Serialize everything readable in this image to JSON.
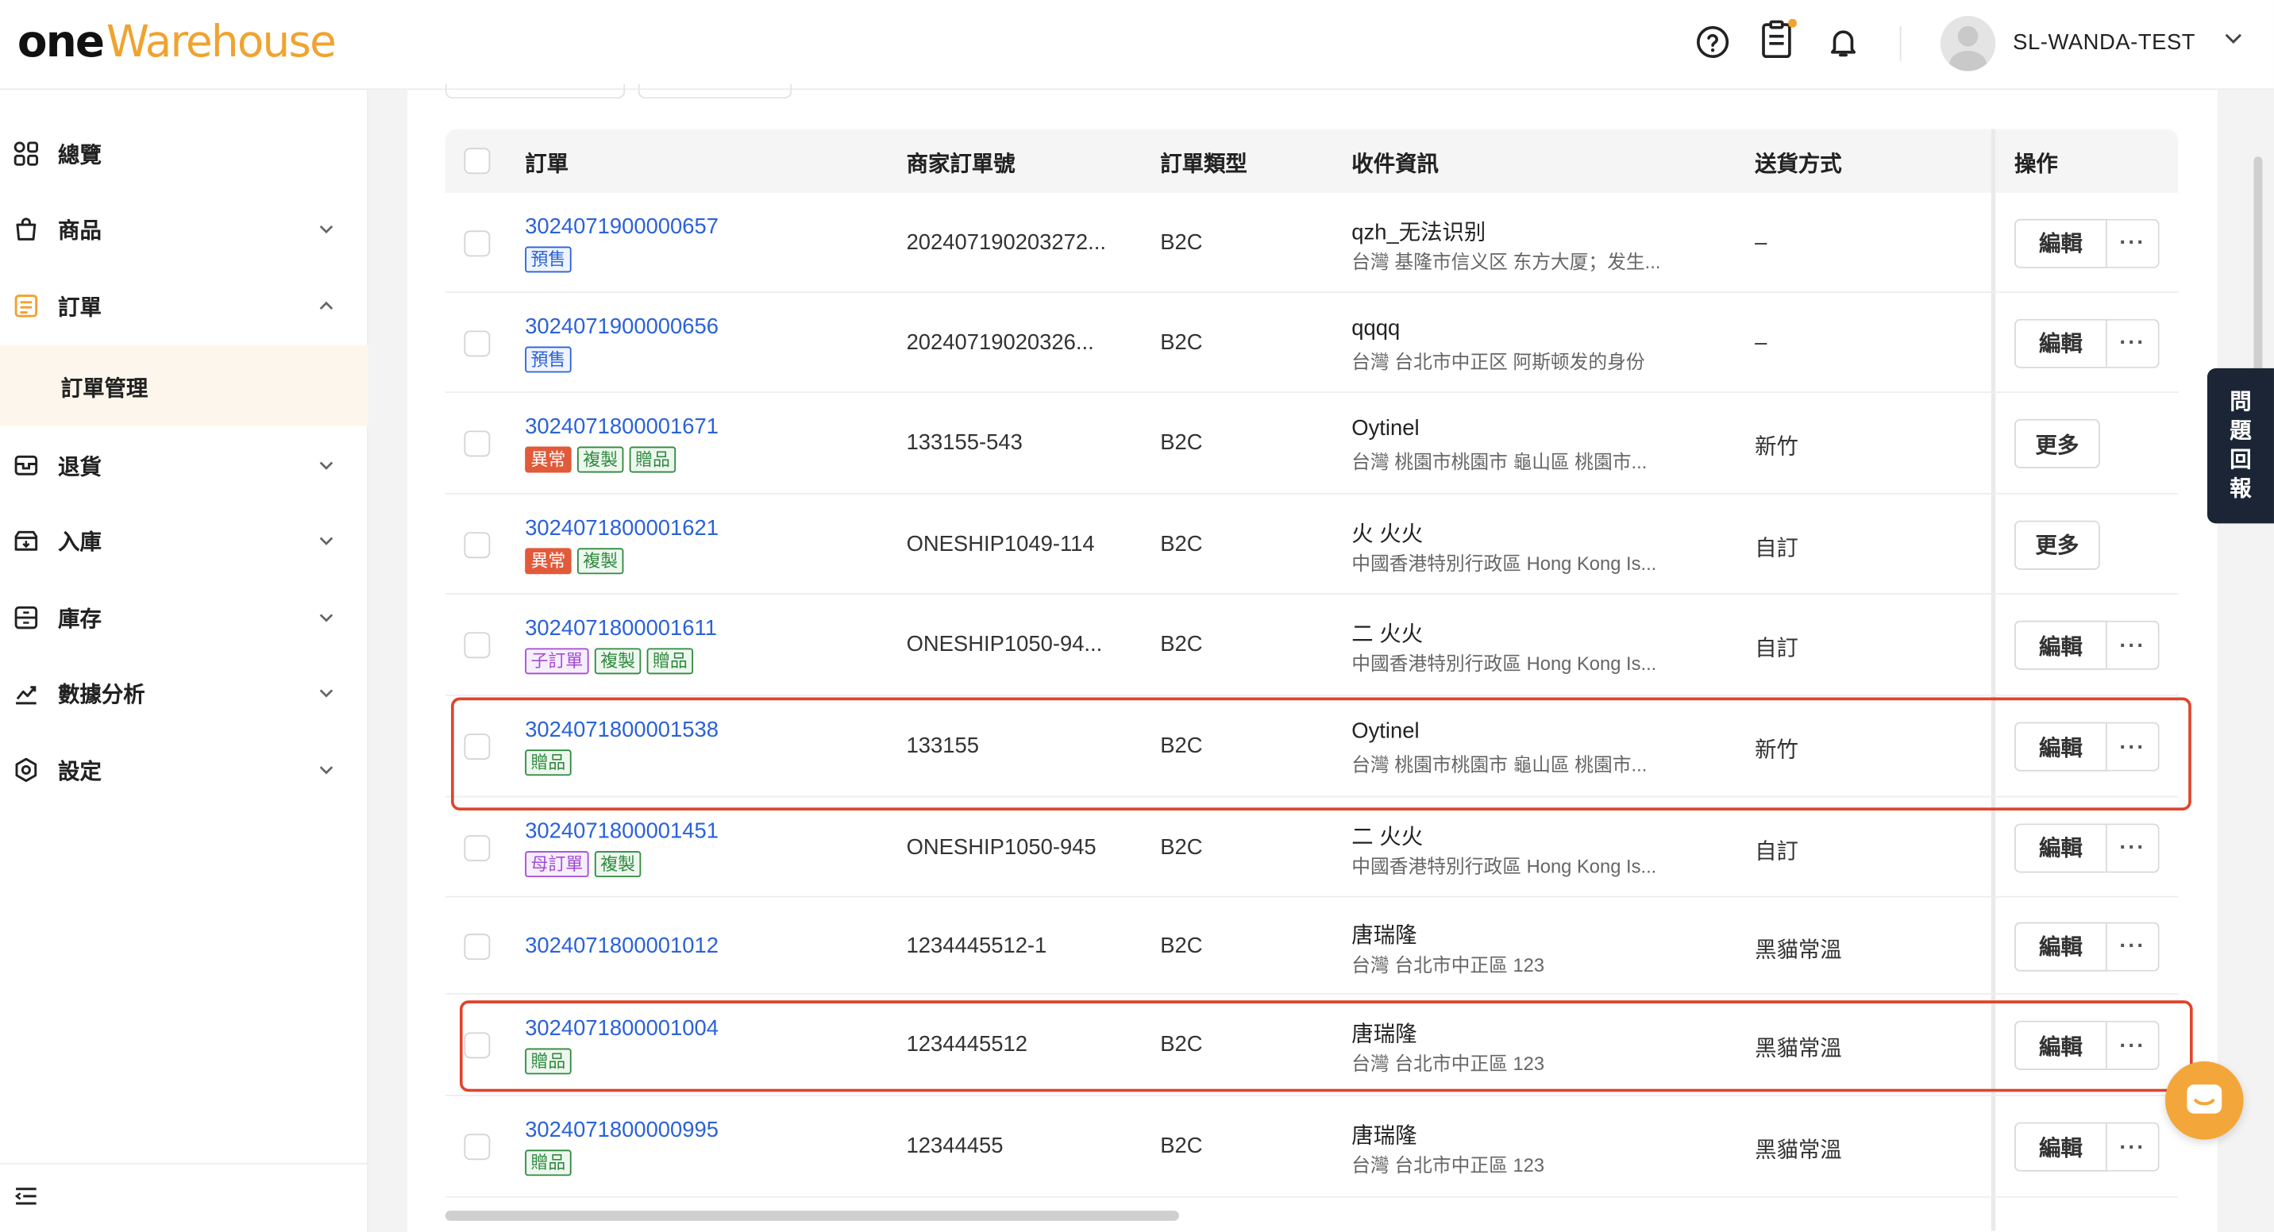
{
  "header": {
    "logo_one": "one",
    "logo_warehouse": "Warehouse",
    "username": "SL-WANDA-TEST"
  },
  "sidebar": {
    "items": [
      {
        "label": "總覽",
        "icon": "dashboard-icon"
      },
      {
        "label": "商品",
        "icon": "product-bag-icon"
      },
      {
        "label": "訂單",
        "icon": "order-icon"
      },
      {
        "label": "退貨",
        "icon": "return-icon"
      },
      {
        "label": "入庫",
        "icon": "inbound-icon"
      },
      {
        "label": "庫存",
        "icon": "inventory-icon"
      },
      {
        "label": "數據分析",
        "icon": "analytics-icon"
      },
      {
        "label": "設定",
        "icon": "settings-icon"
      }
    ],
    "sub_item": "訂單管理"
  },
  "table": {
    "columns": [
      "訂單",
      "商家訂單號",
      "訂單類型",
      "收件資訊",
      "送貨方式",
      "操作"
    ],
    "rows": [
      {
        "order_no": "3024071900000657",
        "tags": [
          {
            "text": "預售",
            "type": "presale"
          }
        ],
        "merchant_no": "202407190203272...",
        "type": "B2C",
        "name": "qzh_无法识别",
        "addr": "台灣 基隆市信义区 东方大厦；发生...",
        "ship": "–",
        "actions": [
          "編輯",
          "···"
        ]
      },
      {
        "order_no": "3024071900000656",
        "tags": [
          {
            "text": "預售",
            "type": "presale"
          }
        ],
        "merchant_no": "20240719020326...",
        "type": "B2C",
        "name": "qqqq",
        "addr": "台灣 台北市中正区 阿斯顿发的身份",
        "ship": "–",
        "actions": [
          "編輯",
          "···"
        ]
      },
      {
        "order_no": "3024071800001671",
        "tags": [
          {
            "text": "異常",
            "type": "abnormal"
          },
          {
            "text": "複製",
            "type": "copy"
          },
          {
            "text": "贈品",
            "type": "gift"
          }
        ],
        "merchant_no": "133155-543",
        "type": "B2C",
        "name": "Oytinel",
        "addr": "台灣 桃園市桃園市 龜山區 桃園市...",
        "ship": "新竹",
        "actions": [
          "更多"
        ]
      },
      {
        "order_no": "3024071800001621",
        "tags": [
          {
            "text": "異常",
            "type": "abnormal"
          },
          {
            "text": "複製",
            "type": "copy"
          }
        ],
        "merchant_no": "ONESHIP1049-114",
        "type": "B2C",
        "name": "火 火火",
        "addr": "中國香港特別行政區 Hong Kong Is...",
        "ship": "自訂",
        "actions": [
          "更多"
        ]
      },
      {
        "order_no": "3024071800001611",
        "tags": [
          {
            "text": "子訂單",
            "type": "child"
          },
          {
            "text": "複製",
            "type": "copy"
          },
          {
            "text": "贈品",
            "type": "gift"
          }
        ],
        "merchant_no": "ONESHIP1050-94...",
        "type": "B2C",
        "name": "二 火火",
        "addr": "中國香港特別行政區 Hong Kong Is...",
        "ship": "自訂",
        "actions": [
          "編輯",
          "···"
        ]
      },
      {
        "order_no": "3024071800001538",
        "tags": [
          {
            "text": "贈品",
            "type": "gift"
          }
        ],
        "merchant_no": "133155",
        "type": "B2C",
        "name": "Oytinel",
        "addr": "台灣 桃園市桃園市 龜山區 桃園市...",
        "ship": "新竹",
        "actions": [
          "編輯",
          "···"
        ]
      },
      {
        "order_no": "3024071800001451",
        "tags": [
          {
            "text": "母訂單",
            "type": "parent"
          },
          {
            "text": "複製",
            "type": "copy"
          }
        ],
        "merchant_no": "ONESHIP1050-945",
        "type": "B2C",
        "name": "二 火火",
        "addr": "中國香港特別行政區 Hong Kong Is...",
        "ship": "自訂",
        "actions": [
          "編輯",
          "···"
        ]
      },
      {
        "order_no": "3024071800001012",
        "tags": [],
        "merchant_no": "1234445512-1",
        "type": "B2C",
        "name": "唐瑞隆",
        "addr": "台灣 台北市中正區 123",
        "ship": "黑貓常溫",
        "actions": [
          "編輯",
          "···"
        ]
      },
      {
        "order_no": "3024071800001004",
        "tags": [
          {
            "text": "贈品",
            "type": "gift"
          }
        ],
        "merchant_no": "1234445512",
        "type": "B2C",
        "name": "唐瑞隆",
        "addr": "台灣 台北市中正區 123",
        "ship": "黑貓常溫",
        "actions": [
          "編輯",
          "···"
        ]
      },
      {
        "order_no": "3024071800000995",
        "tags": [
          {
            "text": "贈品",
            "type": "gift"
          }
        ],
        "merchant_no": "12344455",
        "type": "B2C",
        "name": "唐瑞隆",
        "addr": "台灣 台北市中正區 123",
        "ship": "黑貓常溫",
        "actions": [
          "編輯",
          "···"
        ]
      }
    ]
  },
  "feedback": {
    "label": [
      "問",
      "題",
      "回",
      "報"
    ]
  },
  "colors": {
    "brand_orange": "#f0a330",
    "link_blue": "#2a62d8",
    "highlight_red": "#e0442c"
  }
}
